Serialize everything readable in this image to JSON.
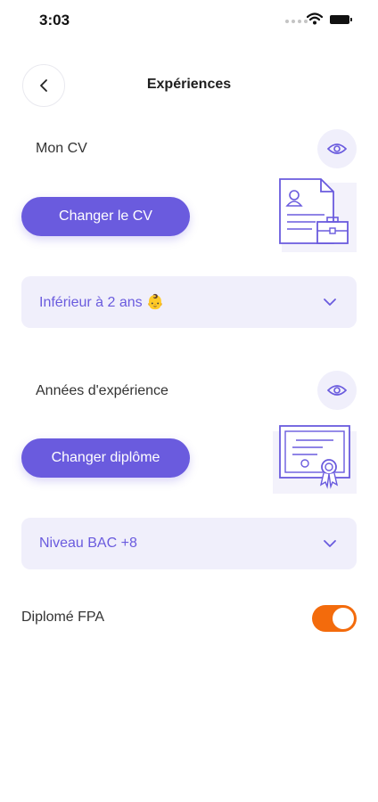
{
  "status_bar": {
    "time": "3:03"
  },
  "header": {
    "title": "Expériences"
  },
  "cv_section": {
    "label": "Mon CV",
    "button_label": "Changer le CV",
    "dropdown_value": "Inférieur à 2 ans 👶"
  },
  "diploma_section": {
    "label": "Années d'expérience",
    "button_label": "Changer diplôme",
    "dropdown_value": "Niveau BAC +8"
  },
  "fpa": {
    "label": "Diplomé FPA",
    "enabled": true
  },
  "colors": {
    "accent": "#6a5bde",
    "accent_light": "#f0effb",
    "toggle_on": "#f36b0c"
  },
  "icons": [
    "back-chevron-icon",
    "eye-icon",
    "cv-document-icon",
    "diploma-certificate-icon",
    "chevron-down-icon",
    "wifi-icon",
    "battery-icon"
  ]
}
